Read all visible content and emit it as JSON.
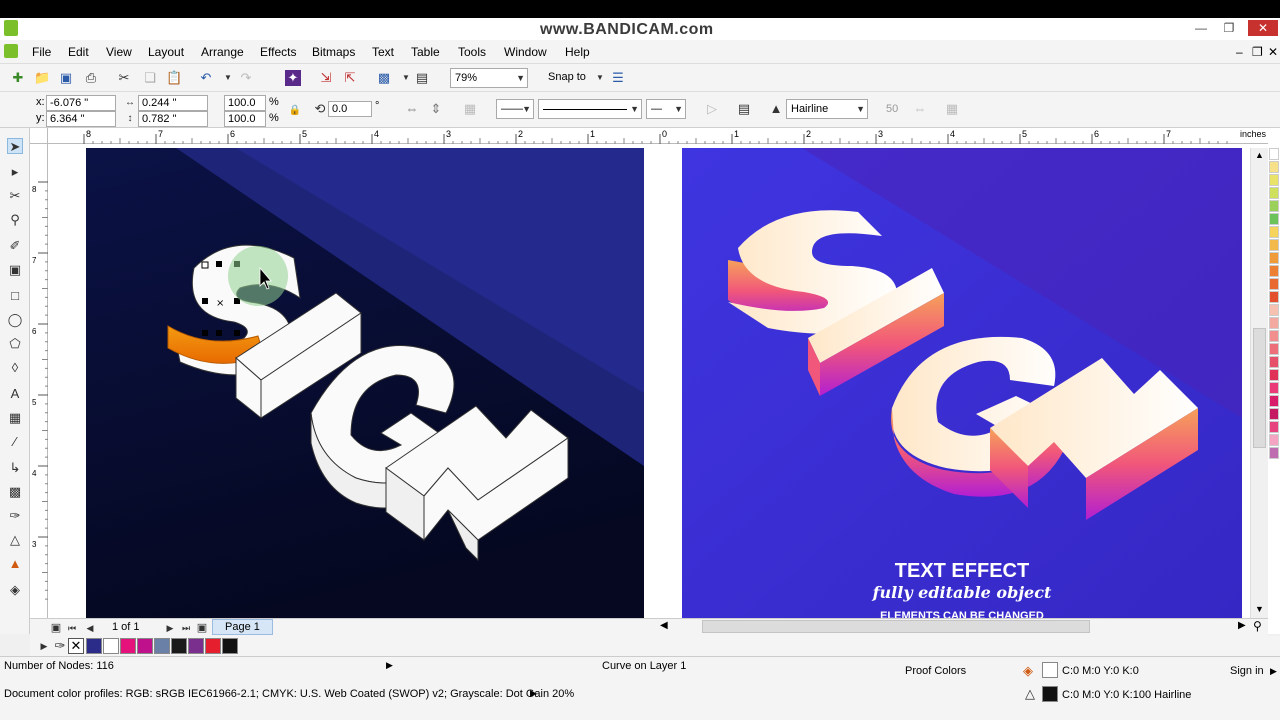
{
  "titlebar": {
    "watermark": "www.BANDICAM.com"
  },
  "menu": {
    "items": [
      {
        "label": "File"
      },
      {
        "label": "Edit"
      },
      {
        "label": "View"
      },
      {
        "label": "Layout"
      },
      {
        "label": "Arrange"
      },
      {
        "label": "Effects"
      },
      {
        "label": "Bitmaps"
      },
      {
        "label": "Text"
      },
      {
        "label": "Table"
      },
      {
        "label": "Tools"
      },
      {
        "label": "Window"
      },
      {
        "label": "Help"
      }
    ]
  },
  "toolbar": {
    "zoom": "79%",
    "snap_label": "Snap to"
  },
  "properties": {
    "x": "-6.076 \"",
    "y": "6.364 \"",
    "width": "0.244 \"",
    "height": "0.782 \"",
    "scale_x": "100.0",
    "scale_y": "100.0",
    "percent": "%",
    "angle": "0.0",
    "degree": "°",
    "outline_width": "Hairline",
    "miter": "50"
  },
  "rulers": {
    "unit": "inches",
    "h_ticks": [
      "8",
      "7",
      "6",
      "5",
      "4",
      "3",
      "2",
      "1",
      "0",
      "1",
      "2",
      "3",
      "4",
      "5",
      "6",
      "7"
    ],
    "v_ticks": [
      "8",
      "7",
      "6",
      "5",
      "4",
      "3"
    ]
  },
  "artwork_left": {
    "text": "SIGN"
  },
  "artwork_right": {
    "text": "SIGN",
    "caption_title": "TEXT EFFECT",
    "caption_script": "fully editable object",
    "caption_small": "ELEMENTS CAN BE CHANGED"
  },
  "pagebar": {
    "page_count": "1 of 1",
    "page_tab": "Page 1"
  },
  "color_well": {
    "swatches": [
      "#2b2c8a",
      "#ffffff",
      "#e4127a",
      "#c0118c",
      "#6a80a6",
      "#1a1a1a",
      "#7a2f8f",
      "#e51f2e",
      "#111111"
    ]
  },
  "palette": {
    "colors": [
      "#ffffff",
      "#f7e08a",
      "#e9e36a",
      "#cfe05c",
      "#9bd05a",
      "#6cc35a",
      "#f6d35a",
      "#f3b94a",
      "#ef9b3a",
      "#ec7f32",
      "#e86a30",
      "#e2502d",
      "#f7c1b2",
      "#f4a9a0",
      "#f08f8e",
      "#ec6f7a",
      "#e65068",
      "#e03257",
      "#ea3a78",
      "#d81d6b",
      "#c51a62",
      "#e7447f",
      "#f5a3c2",
      "#c06cb0"
    ]
  },
  "status": {
    "nodes": "Number of Nodes: 116",
    "object": "Curve on Layer 1",
    "proof": "Proof Colors",
    "fill": "C:0 M:0 Y:0 K:0",
    "outline": "C:0 M:0 Y:0 K:100  Hairline",
    "signin": "Sign in",
    "profiles": "Document color profiles: RGB: sRGB IEC61966-2.1; CMYK: U.S. Web Coated (SWOP) v2; Grayscale: Dot Gain 20%"
  },
  "colors": {
    "left_bg_dark": "#0a0f3a",
    "left_bg_light": "#2a2f8f",
    "right_bg": "#3a2fd6",
    "accent_orange": "#f29a1a",
    "accent_purple": "#b21fd2"
  }
}
